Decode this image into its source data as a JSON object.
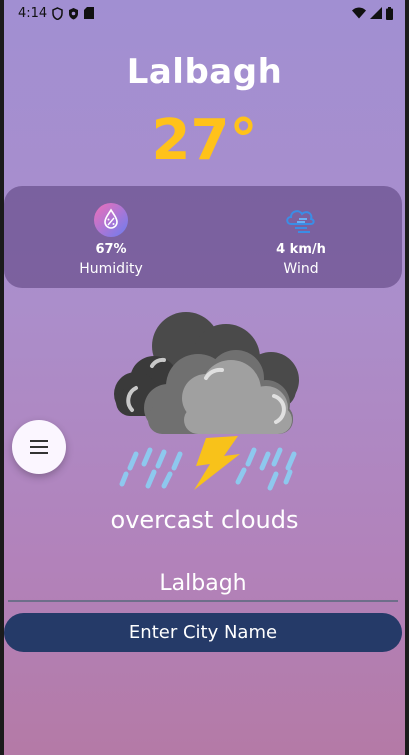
{
  "status_bar": {
    "time": "4:14",
    "icons": [
      "shield-icon",
      "shield-play-icon",
      "sd-card-icon",
      "wifi-icon",
      "signal-icon",
      "battery-icon"
    ]
  },
  "weather": {
    "city": "Lalbagh",
    "temperature": "27°",
    "humidity_value": "67%",
    "humidity_label": "Humidity",
    "wind_value": "4 km/h",
    "wind_label": "Wind",
    "condition": "overcast clouds",
    "condition_icon": "thunderstorm-rain-icon"
  },
  "search": {
    "value": "Lalbagh",
    "button_label": "Enter City Name"
  },
  "menu": {
    "icon": "hamburger-menu-icon"
  },
  "colors": {
    "temperature": "#ffc21a",
    "card": "#5f4682",
    "button": "#253a68",
    "background_top": "#a18fd2",
    "background_bottom": "#b47aa6"
  }
}
